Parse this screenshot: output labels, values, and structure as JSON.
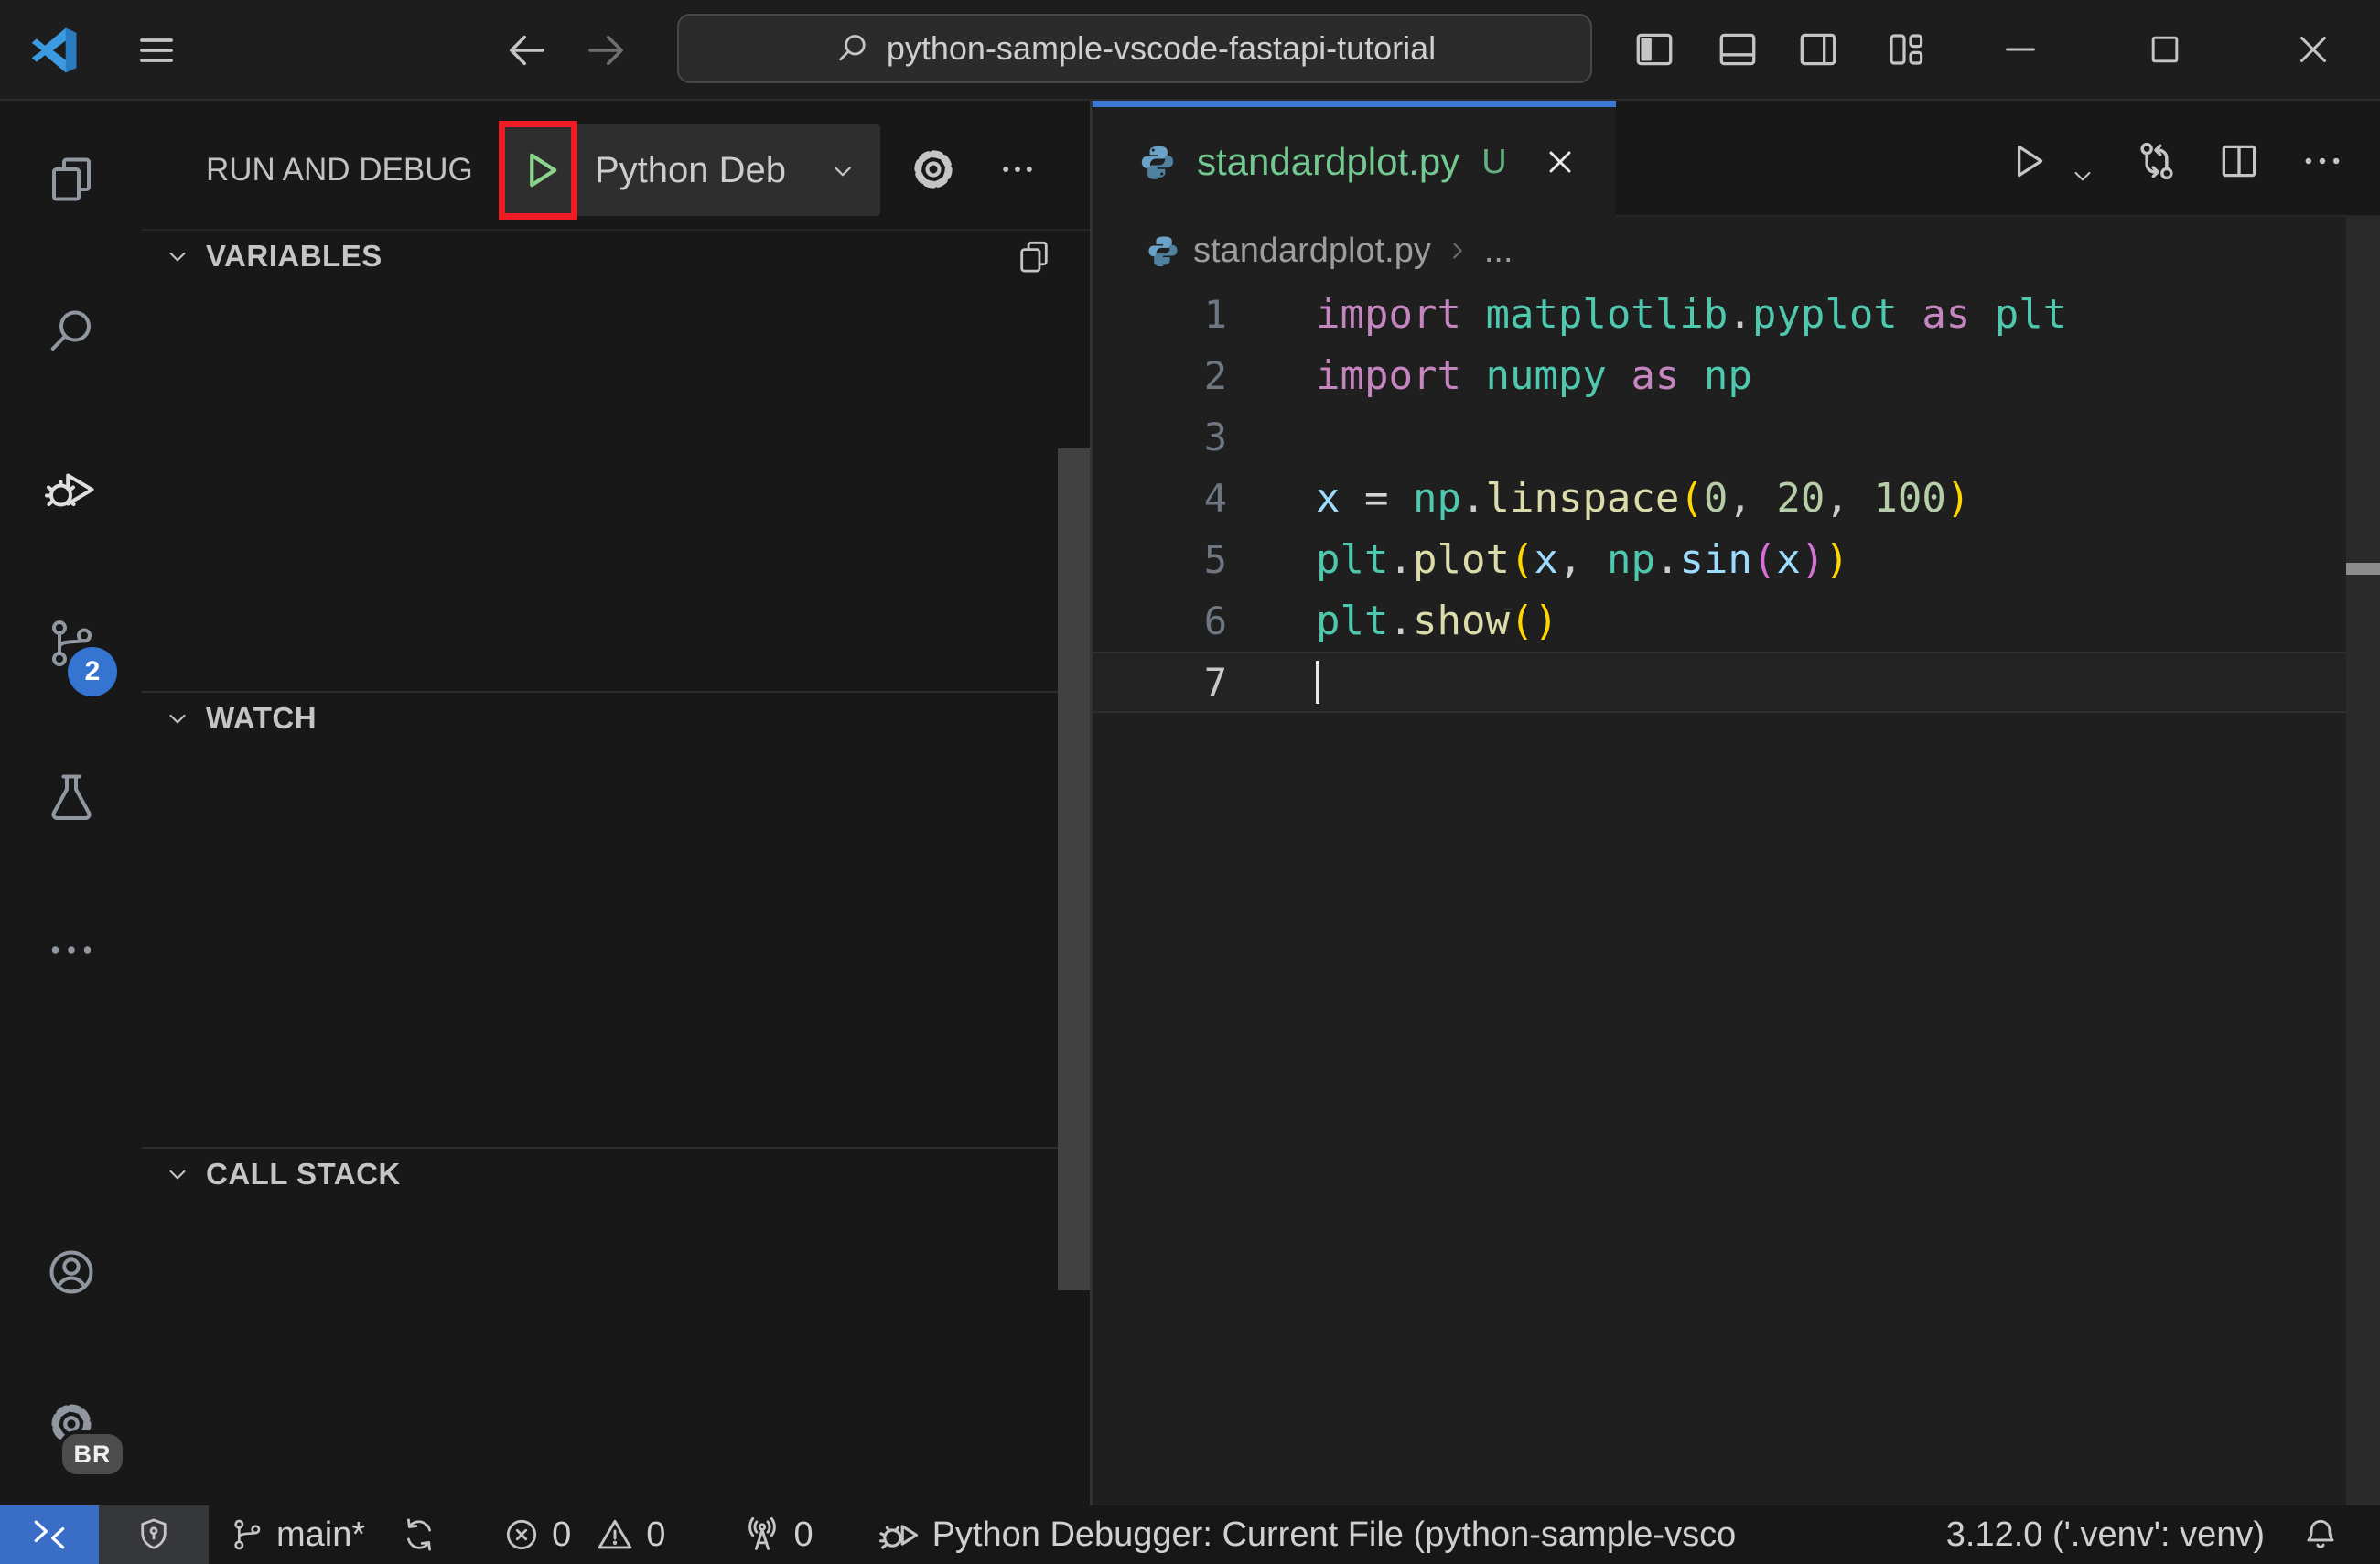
{
  "window": {
    "search_value": "python-sample-vscode-fastapi-tutorial"
  },
  "activity_bar": {
    "scm_badge": "2",
    "profile_badge": "BR",
    "items": [
      "explorer",
      "search",
      "run-and-debug",
      "source-control",
      "testing",
      "more",
      "account",
      "settings"
    ]
  },
  "sidebar": {
    "title": "RUN AND DEBUG",
    "config_name": "Python Deb",
    "sections": [
      {
        "label": "VARIABLES"
      },
      {
        "label": "WATCH"
      },
      {
        "label": "CALL STACK"
      }
    ]
  },
  "editor": {
    "tab": {
      "name": "standardplot.py",
      "dirty": "U"
    },
    "breadcrumb": {
      "file": "standardplot.py",
      "more": "..."
    },
    "active_line": 7,
    "lines": [
      {
        "n": "1",
        "tokens": [
          [
            "import",
            "kw"
          ],
          [
            " ",
            "txt"
          ],
          [
            "matplotlib",
            "mod"
          ],
          [
            ".",
            "pn"
          ],
          [
            "pyplot",
            "mod"
          ],
          [
            " ",
            "txt"
          ],
          [
            "as",
            "kw"
          ],
          [
            " ",
            "txt"
          ],
          [
            "plt",
            "mod"
          ]
        ]
      },
      {
        "n": "2",
        "tokens": [
          [
            "import",
            "kw"
          ],
          [
            " ",
            "txt"
          ],
          [
            "numpy",
            "mod"
          ],
          [
            " ",
            "txt"
          ],
          [
            "as",
            "kw"
          ],
          [
            " ",
            "txt"
          ],
          [
            "np",
            "mod"
          ]
        ]
      },
      {
        "n": "3",
        "tokens": []
      },
      {
        "n": "4",
        "tokens": [
          [
            "x",
            "vr"
          ],
          [
            " ",
            "txt"
          ],
          [
            "=",
            "txt"
          ],
          [
            " ",
            "txt"
          ],
          [
            "np",
            "mod"
          ],
          [
            ".",
            "pn"
          ],
          [
            "linspace",
            "fn"
          ],
          [
            "(",
            "b1"
          ],
          [
            "0",
            "num"
          ],
          [
            ",",
            "pn"
          ],
          [
            " ",
            "txt"
          ],
          [
            "20",
            "num"
          ],
          [
            ",",
            "pn"
          ],
          [
            " ",
            "txt"
          ],
          [
            "100",
            "num"
          ],
          [
            ")",
            "b1"
          ]
        ]
      },
      {
        "n": "5",
        "tokens": [
          [
            "plt",
            "mod"
          ],
          [
            ".",
            "pn"
          ],
          [
            "plot",
            "fn"
          ],
          [
            "(",
            "b1"
          ],
          [
            "x",
            "vr"
          ],
          [
            ",",
            "pn"
          ],
          [
            " ",
            "txt"
          ],
          [
            "np",
            "mod"
          ],
          [
            ".",
            "pn"
          ],
          [
            "sin",
            "vr"
          ],
          [
            "(",
            "b2"
          ],
          [
            "x",
            "vr"
          ],
          [
            ")",
            "b2"
          ],
          [
            ")",
            "b1"
          ]
        ]
      },
      {
        "n": "6",
        "tokens": [
          [
            "plt",
            "mod"
          ],
          [
            ".",
            "pn"
          ],
          [
            "show",
            "fn"
          ],
          [
            "(",
            "b1"
          ],
          [
            ")",
            "b1"
          ]
        ]
      },
      {
        "n": "7",
        "tokens": [],
        "cursor": true,
        "active": true
      }
    ]
  },
  "status_bar": {
    "branch": "main*",
    "errors": "0",
    "warnings": "0",
    "ports": "0",
    "debugger": "Python Debugger: Current File (python-sample-vsco",
    "interpreter": "3.12.0 ('.venv': venv)"
  },
  "icons": [
    "vscode-logo",
    "menu",
    "arrow-left",
    "arrow-right",
    "search",
    "layout-sidebar-left",
    "layout-panel",
    "layout-sidebar-right",
    "customize-layout",
    "minimize",
    "maximize",
    "close",
    "files",
    "search",
    "debug-alt",
    "source-control",
    "beaker",
    "ellipsis",
    "account",
    "gear",
    "play",
    "chevron-down",
    "copy",
    "python",
    "run",
    "compare-changes",
    "split-editor",
    "chevron-right",
    "remote",
    "shield",
    "git-branch",
    "sync",
    "error",
    "warning",
    "radio-tower",
    "debug-start",
    "bell"
  ],
  "colors": {
    "base": {
      "titlebar": "#1d1d1d",
      "chrome": "#181818",
      "editor": "#1f1f1f",
      "statusbar": "#171717",
      "border": "#2b2b2b",
      "input": "#2b2b2b",
      "control": "#2e2e2e",
      "trust": "#35373a",
      "currentline": "#232323",
      "currentlineborder": "#2e2e2e"
    },
    "accent": {
      "badge": "#3574d0",
      "remote": "#3a6ec6",
      "tabtop": "#3c78d8",
      "filegreen": "#73c991",
      "play": "#8bd48b",
      "red": "#ed1c24",
      "logo": "#3b9ae0"
    },
    "text": {
      "ui": "#cccccc",
      "dim": "#9d9d9d",
      "icon": "#c5c5c5",
      "iconinactive": "#9097a0"
    },
    "syntax": {
      "kw": "#C586C0",
      "mod": "#4EC9B0",
      "fn": "#DCDCAA",
      "vr": "#9CDCFE",
      "num": "#B5CEA8",
      "pn": "#cccccc",
      "b1": "#FFD700",
      "b2": "#D670D6",
      "txt": "#d4d4d4",
      "ln": "#6e7681",
      "lnactive": "#c8c8c8"
    }
  }
}
